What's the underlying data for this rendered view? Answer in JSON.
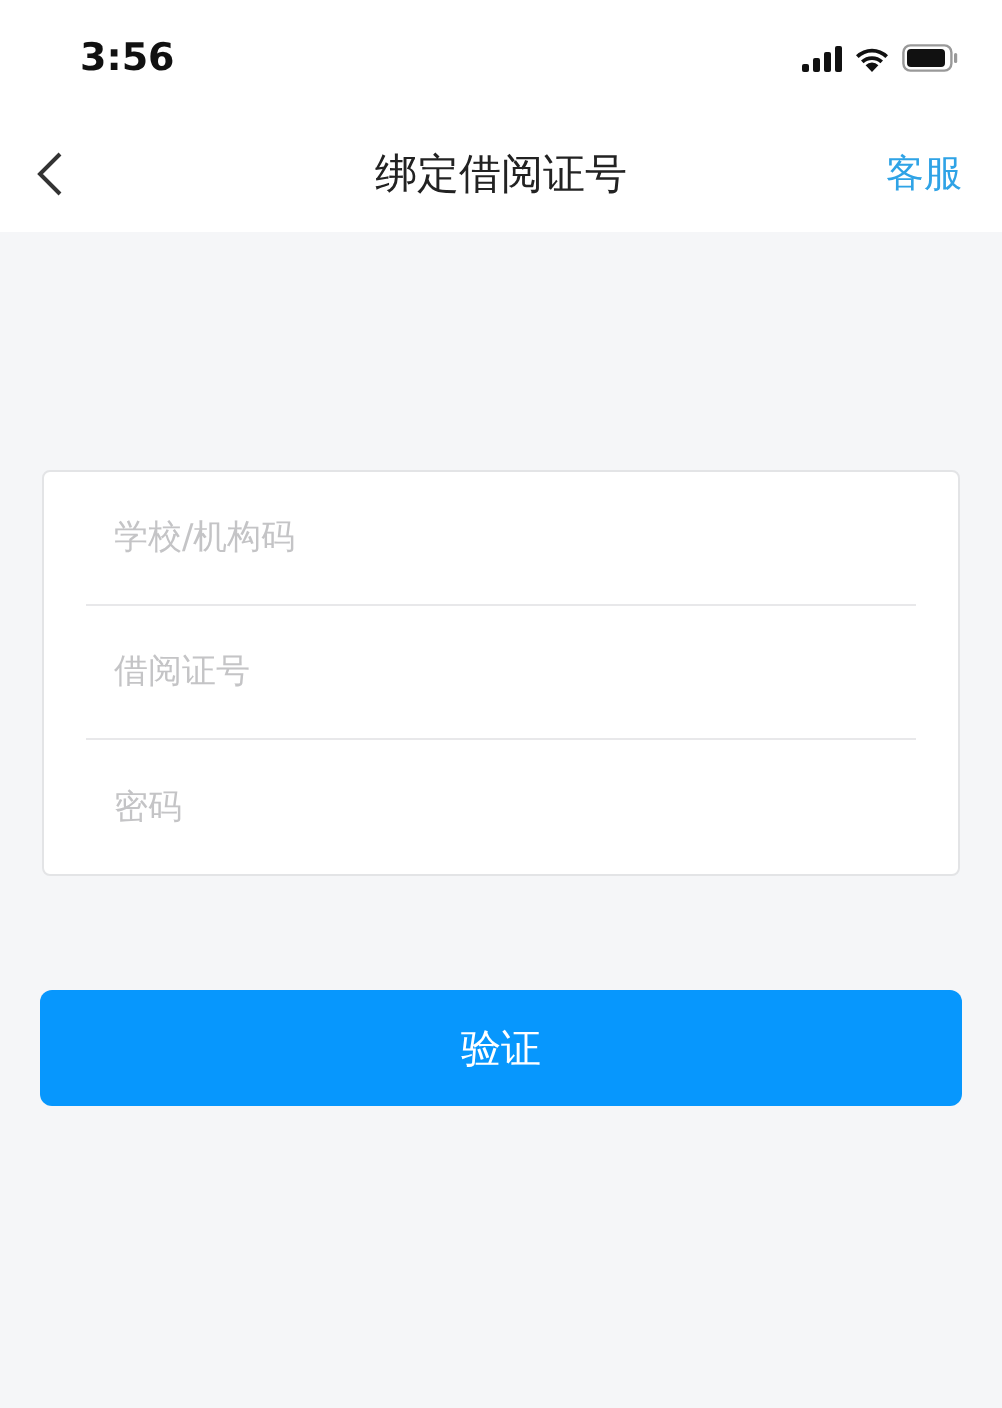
{
  "status_bar": {
    "time": "3:56"
  },
  "nav": {
    "title": "绑定借阅证号",
    "action": "客服"
  },
  "form": {
    "fields": [
      {
        "placeholder": "学校/机构码"
      },
      {
        "placeholder": "借阅证号"
      },
      {
        "placeholder": "密码"
      }
    ]
  },
  "submit": {
    "label": "验证"
  }
}
